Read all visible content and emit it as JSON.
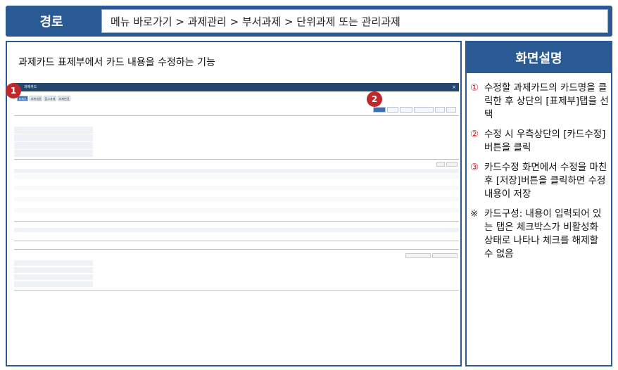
{
  "path": {
    "label": "경로",
    "text": "메뉴 바로가기 > 과제관리 > 부서과제 > 단위과제 또는 관리과제"
  },
  "main": {
    "title": "과제카드 표제부에서 카드 내용을 수정하는 기능"
  },
  "screenshot": {
    "header_title": "과제카드",
    "markers": [
      "1",
      "2"
    ],
    "tabs": [
      "표제부",
      "과제내용",
      "참고과제",
      "과제변경"
    ]
  },
  "side": {
    "title": "화면설명",
    "items": [
      {
        "num": "①",
        "text": "수정할 과제카드의 카드명을 클릭한 후 상단의 [표제부]탭을 선택"
      },
      {
        "num": "②",
        "text": "수정 시 우측상단의 [카드수정]버튼을 클릭"
      },
      {
        "num": "③",
        "text": "카드수정 화면에서 수정을 마친 후 [저장]버튼을 클릭하면 수정내용이 저장"
      },
      {
        "num": "※",
        "text": "카드구성: 내용이 입력되어 있는 탭은 체크박스가 비활성화 상태로 나타나 체크를 해제할 수 없음"
      }
    ]
  },
  "colors": {
    "accent": "#2a5a94",
    "marker": "#c0282b"
  }
}
